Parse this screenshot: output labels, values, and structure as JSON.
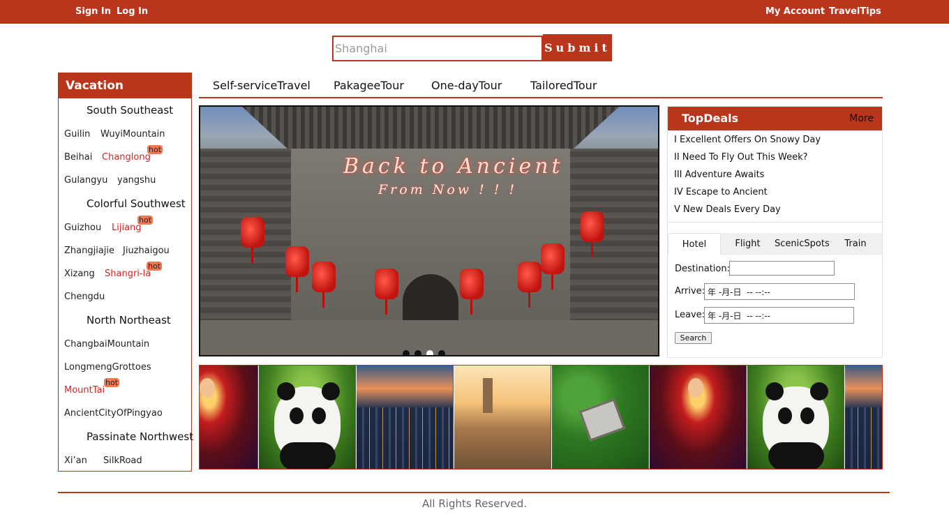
{
  "topbar": {
    "sign_in": "Sign In",
    "log_in": "Log In",
    "my_account": "My Account",
    "travel_tips": "TravelTips"
  },
  "search": {
    "placeholder": "Shanghai",
    "submit_label": "Submit"
  },
  "sidebar": {
    "title": "Vacation",
    "regions": [
      {
        "name": "South Southeast",
        "places": [
          {
            "name": "Guilin",
            "hot": false
          },
          {
            "name": "WuyiMountain",
            "hot": false
          },
          {
            "name": "Beihai",
            "hot": false
          },
          {
            "name": "Changlong",
            "hot": true
          },
          {
            "name": "Gulangyu",
            "hot": false
          },
          {
            "name": "yangshu",
            "hot": false
          }
        ]
      },
      {
        "name": "Colorful Southwest",
        "places": [
          {
            "name": "Guizhou",
            "hot": false
          },
          {
            "name": "Lijiang",
            "hot": true
          },
          {
            "name": "Zhangjiajie",
            "hot": false
          },
          {
            "name": "Jiuzhaigou",
            "hot": false
          },
          {
            "name": "Xizang",
            "hot": false
          },
          {
            "name": "Shangri-la",
            "hot": true
          },
          {
            "name": "Chengdu",
            "hot": false
          }
        ]
      },
      {
        "name": "North Northeast",
        "places": [
          {
            "name": "ChangbaiMountain",
            "hot": false
          },
          {
            "name": "LongmengGrottoes",
            "hot": false
          },
          {
            "name": "MountTai",
            "hot": true
          },
          {
            "name": "AncientCityOfPingyao",
            "hot": false
          }
        ]
      },
      {
        "name": "Passinate Northwest",
        "places": [
          {
            "name": "Xi’an",
            "hot": false
          },
          {
            "name": "SilkRoad",
            "hot": false
          }
        ]
      }
    ],
    "hot_label": "hot"
  },
  "tabs": [
    "Self-serviceTravel",
    "PakageeTour",
    "One-dayTour",
    "TailoredTour"
  ],
  "banner": {
    "title": "Back to Ancient",
    "subtitle": "From Now ! ! !",
    "slide_count": 4,
    "active_slide": 3
  },
  "deals": {
    "title": "TopDeals",
    "more": "More",
    "items": [
      "I  Excellent Offers On Snowy Day",
      "II  Need To Fly Out This Week?",
      "III  Adventure Awaits",
      "IV  Escape to Ancient",
      "V  New Deals Every Day"
    ]
  },
  "booking": {
    "tabs": [
      "Hotel",
      "Flight",
      "ScenicSpots",
      "Train"
    ],
    "active_tab": "Hotel",
    "destination_label": "Destination:",
    "destination_value": "",
    "arrive_label": "Arrive:",
    "arrive_value": "年 -月-日  -- --:--",
    "leave_label": "Leave:",
    "leave_value": "年 -月-日  -- --:--",
    "search_label": "Search"
  },
  "footer": {
    "text": "All Rights Reserved."
  },
  "colors": {
    "accent": "#b9351c",
    "hot_text": "#d22222",
    "hot_badge": "#ef7752"
  }
}
